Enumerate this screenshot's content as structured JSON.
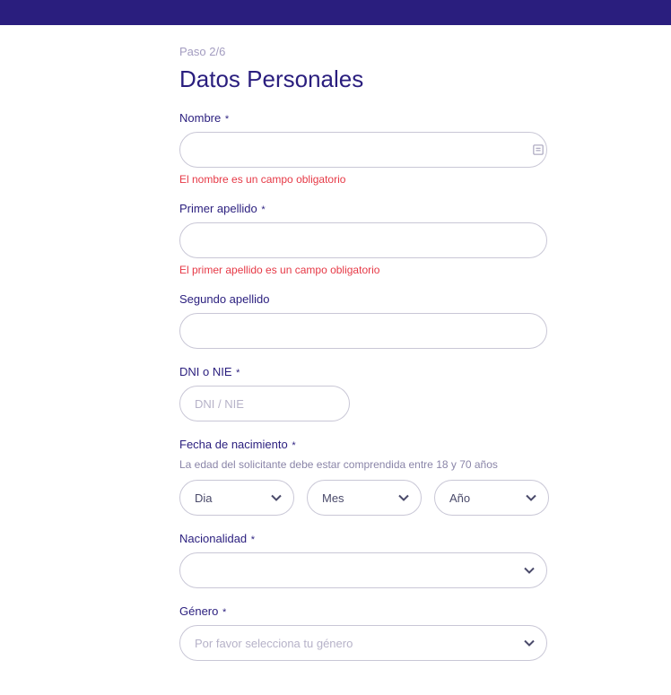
{
  "step": "Paso 2/6",
  "title": "Datos Personales",
  "fields": {
    "nombre": {
      "label": "Nombre",
      "required": "*",
      "value": "",
      "error": "El nombre es un campo obligatorio"
    },
    "primer_apellido": {
      "label": "Primer apellido",
      "required": "*",
      "value": "",
      "error": "El primer apellido es un campo obligatorio"
    },
    "segundo_apellido": {
      "label": "Segundo apellido",
      "value": ""
    },
    "dni_nie": {
      "label": "DNI o NIE",
      "required": "*",
      "placeholder": "DNI / NIE",
      "value": ""
    },
    "fecha_nacimiento": {
      "label": "Fecha de nacimiento",
      "required": "*",
      "hint": "La edad del solicitante debe estar comprendida entre 18 y 70 años",
      "dia": "Dia",
      "mes": "Mes",
      "ano": "Año"
    },
    "nacionalidad": {
      "label": "Nacionalidad",
      "required": "*",
      "value": ""
    },
    "genero": {
      "label": "Género",
      "required": "*",
      "placeholder": "Por favor selecciona tu género"
    }
  }
}
